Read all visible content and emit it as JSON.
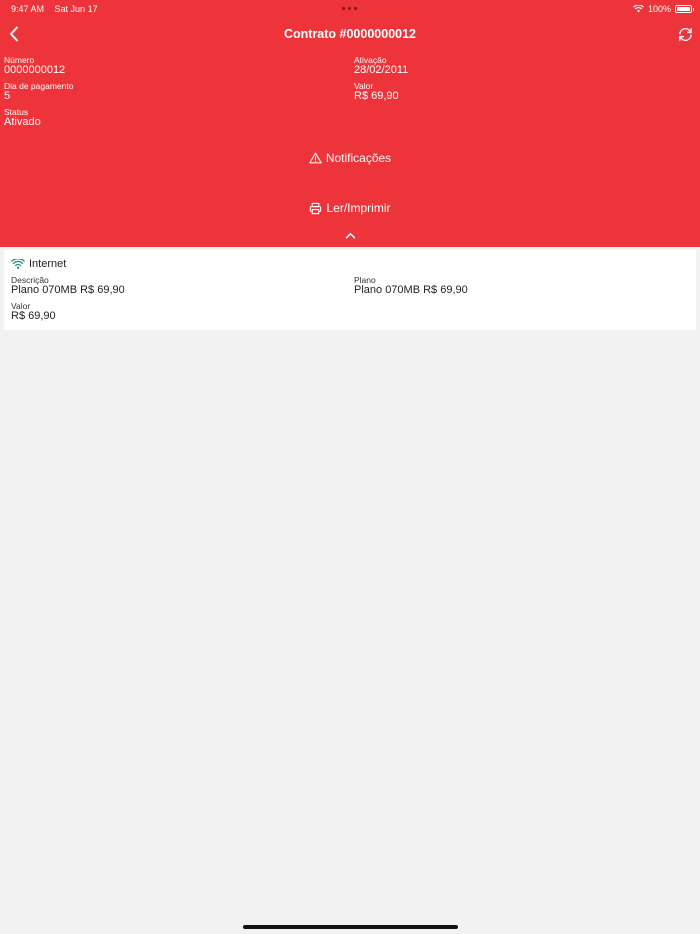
{
  "status_bar": {
    "time": "9:47 AM",
    "date": "Sat Jun 17",
    "battery": "100%"
  },
  "header": {
    "title": "Contrato #0000000012",
    "back_icon": "chevron-left-icon",
    "refresh_icon": "refresh-icon",
    "background_color": "#ee343b"
  },
  "contract": {
    "numero_label": "Número",
    "numero_value": "0000000012",
    "ativacao_label": "Ativação",
    "ativacao_value": "28/02/2011",
    "dia_label": "Dia de pagamento",
    "dia_value": "5",
    "valor_label": "Valor",
    "valor_value": "R$ 69,90",
    "status_label": "Status",
    "status_value": "Ativado"
  },
  "actions": {
    "notificacoes_label": "Notificações",
    "notificacoes_icon": "warning-icon",
    "imprimir_label": "Ler/Imprimir",
    "imprimir_icon": "printer-icon",
    "collapse_icon": "chevron-up-icon"
  },
  "service": {
    "title": "Internet",
    "icon": "wifi-icon",
    "icon_color": "#1a8a86",
    "descricao_label": "Descrição",
    "descricao_value": "Plano 070MB R$ 69,90",
    "plano_label": "Plano",
    "plano_value": "Plano 070MB R$ 69,90",
    "valor_label": "Valor",
    "valor_value": "R$ 69,90"
  }
}
